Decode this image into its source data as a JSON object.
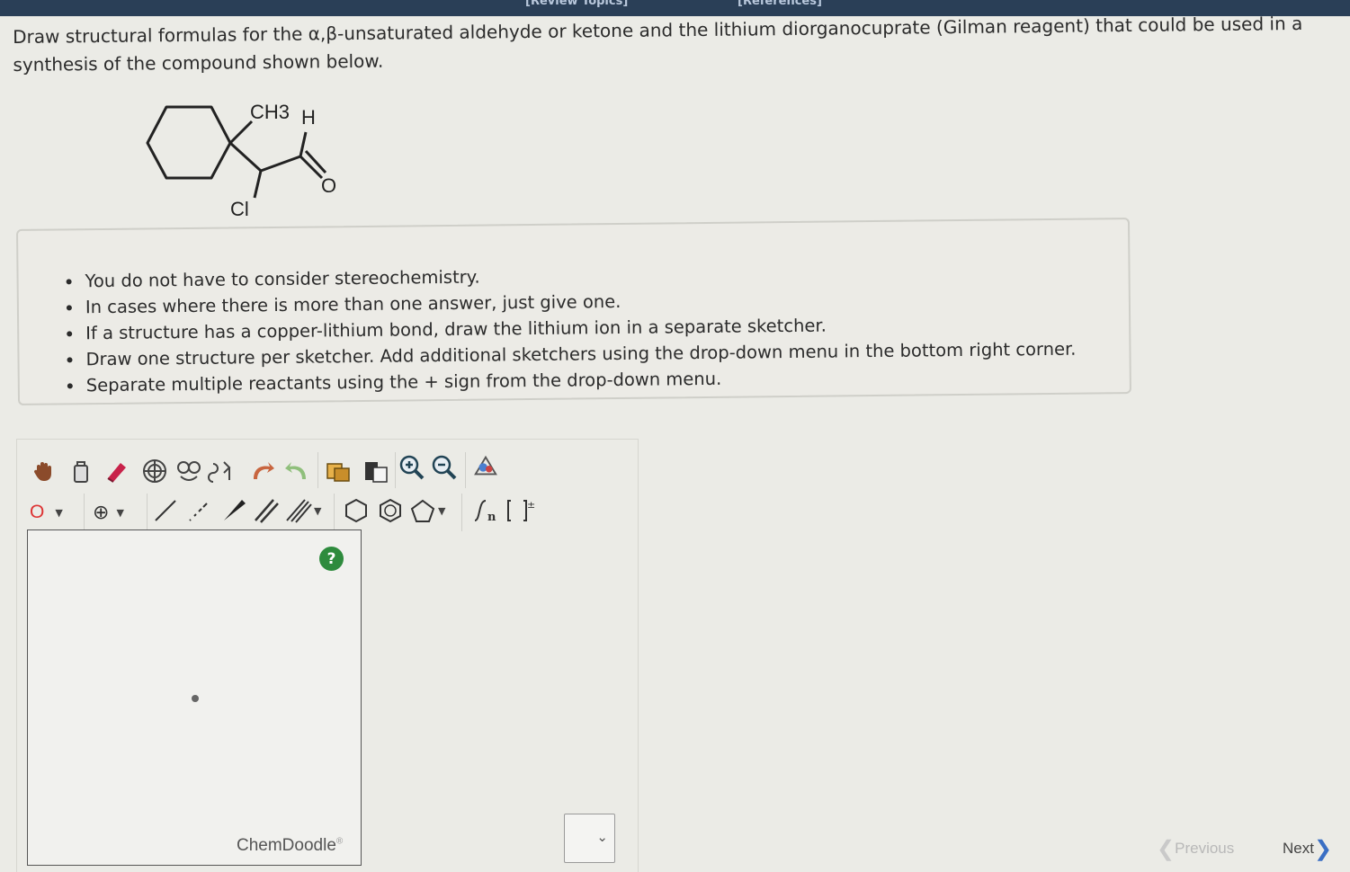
{
  "top_bar": {
    "review_topics": "[Review Topics]",
    "references": "[References]"
  },
  "question": {
    "text": "Draw structural formulas for the α,β-unsaturated aldehyde or ketone and the lithium diorganocuprate (Gilman reagent) that could be used in a synthesis of the compound shown below."
  },
  "molecule": {
    "labels": {
      "methyl": "CH3",
      "hydrogen": "H",
      "oxygen": "O",
      "chlorine": "Cl"
    }
  },
  "instructions": [
    "You do not have to consider stereochemistry.",
    "In cases where there is more than one answer, just give one.",
    "If a structure has a copper-lithium bond, draw the lithium ion in a separate sketcher.",
    "Draw one structure per sketcher. Add additional sketchers using the drop-down menu in the bottom right corner.",
    "Separate multiple reactants using the + sign from the drop-down menu."
  ],
  "sketcher": {
    "atom_default": "O",
    "charge_symbol": "⊕",
    "help_label": "?",
    "brand": "ChemDoodle",
    "brand_mark": "®",
    "toolbar_row1": [
      "hand-icon",
      "lasso-icon",
      "eraser-icon",
      "center-icon",
      "clean-icon",
      "flip-icon",
      "undo-icon",
      "redo-icon",
      "copy-icon",
      "paste-icon",
      "zoom-in-icon",
      "zoom-out-icon",
      "query-icon"
    ],
    "toolbar_row2": [
      "atom-dropdown",
      "charge-dropdown",
      "single-bond",
      "wedge-hashed",
      "wedge-bold",
      "double-bond",
      "triple-bond",
      "ring-hexagon",
      "ring-benzene",
      "ring-pentagon",
      "sgroup",
      "bracket"
    ]
  },
  "nav": {
    "previous": "Previous",
    "next": "Next"
  }
}
